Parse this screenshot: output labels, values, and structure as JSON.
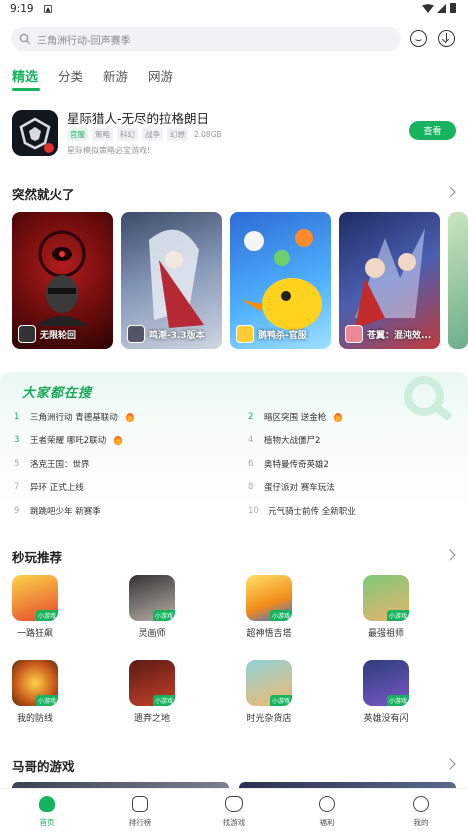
{
  "status_bar": {
    "time": "9:19"
  },
  "search": {
    "placeholder": "三角洲行动-回声赛季"
  },
  "tabs": [
    {
      "label": "精选",
      "active": true
    },
    {
      "label": "分类"
    },
    {
      "label": "新游"
    },
    {
      "label": "网游"
    }
  ],
  "featured": {
    "title": "星际猎人-无尽的拉格朗日",
    "tags": [
      "官服",
      "策略",
      "科幻",
      "战争",
      "幻想"
    ],
    "size": "2.08GB",
    "subtitle": "星际模拟策略必宝游戏!",
    "button": "查看"
  },
  "trending": {
    "title": "突然就火了",
    "cards": [
      {
        "label": "无限轮回"
      },
      {
        "label": "鸣潮-3.3版本"
      },
      {
        "label": "鹅鸭杀-官服"
      },
      {
        "label": "苍翼：混沌效..."
      }
    ]
  },
  "hot_search": {
    "title": "大家都在搜",
    "items": [
      {
        "rank": "1",
        "text": "三角洲行动 青德基联动",
        "fire": true
      },
      {
        "rank": "2",
        "text": "暗区突围 送金枪",
        "fire": true
      },
      {
        "rank": "3",
        "text": "王者荣耀 哪吒2联动",
        "fire": true
      },
      {
        "rank": "4",
        "text": "植物大战僵尸2"
      },
      {
        "rank": "5",
        "text": "洛克王国：世界"
      },
      {
        "rank": "6",
        "text": "奥特曼传奇英雄2"
      },
      {
        "rank": "7",
        "text": "异环 正式上线"
      },
      {
        "rank": "8",
        "text": "蛋仔派对 赛车玩法"
      },
      {
        "rank": "9",
        "text": "跳跳吧少年 新赛季"
      },
      {
        "rank": "10",
        "text": "元气骑士前传 全新职业"
      }
    ]
  },
  "quick_play": {
    "title": "秒玩推荐",
    "badge": "小游戏",
    "games": [
      {
        "name": "一路狂飙"
      },
      {
        "name": "灵画师"
      },
      {
        "name": "超神悟吉塔"
      },
      {
        "name": "最强祖师"
      },
      {
        "name": "我的防线"
      },
      {
        "name": "遗弃之地"
      },
      {
        "name": "时光杂货店"
      },
      {
        "name": "英雄没有闪"
      }
    ]
  },
  "mage": {
    "title": "马哥的游戏"
  },
  "bottom_nav": [
    {
      "label": "首页",
      "active": true
    },
    {
      "label": "排行榜"
    },
    {
      "label": "找游戏"
    },
    {
      "label": "福利"
    },
    {
      "label": "我的"
    }
  ],
  "colors": {
    "accent": "#18b35f"
  }
}
